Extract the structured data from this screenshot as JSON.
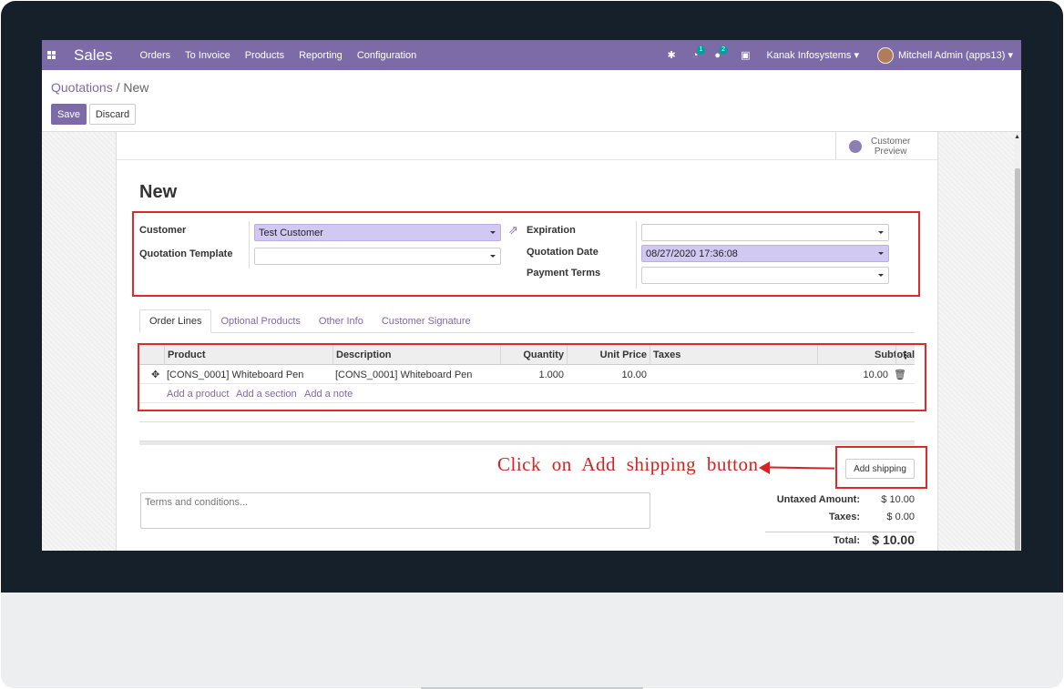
{
  "navbar": {
    "brand": "Sales",
    "menu": [
      "Orders",
      "To Invoice",
      "Products",
      "Reporting",
      "Configuration"
    ],
    "activities_badge": "1",
    "messages_badge": "2",
    "company": "Kanak Infosystems",
    "user": "Mitchell Admin (apps13)"
  },
  "control": {
    "breadcrumb_parent": "Quotations",
    "breadcrumb_separator": "/",
    "breadcrumb_current": "New",
    "save_label": "Save",
    "discard_label": "Discard"
  },
  "form": {
    "customer_preview_line1": "Customer",
    "customer_preview_line2": "Preview",
    "title": "New",
    "customer_label": "Customer",
    "customer_value": "Test Customer",
    "template_label": "Quotation Template",
    "template_value": "",
    "expiration_label": "Expiration",
    "expiration_value": "",
    "quotation_date_label": "Quotation Date",
    "quotation_date_value": "08/27/2020 17:36:08",
    "payment_terms_label": "Payment Terms",
    "payment_terms_value": ""
  },
  "tabs": [
    "Order Lines",
    "Optional Products",
    "Other Info",
    "Customer Signature"
  ],
  "table": {
    "headers": {
      "product": "Product",
      "description": "Description",
      "quantity": "Quantity",
      "unit_price": "Unit Price",
      "taxes": "Taxes",
      "subtotal": "Subtotal"
    },
    "rows": [
      {
        "product": "[CONS_0001] Whiteboard Pen",
        "description": "[CONS_0001] Whiteboard Pen",
        "quantity": "1.000",
        "unit_price": "10.00",
        "taxes": "",
        "subtotal": "10.00"
      }
    ],
    "add_product": "Add a product",
    "add_section": "Add a section",
    "add_note": "Add a note"
  },
  "shipping_button": "Add shipping",
  "annotation": "Click on Add shipping button",
  "terms_placeholder": "Terms and conditions...",
  "totals": {
    "untaxed_label": "Untaxed Amount:",
    "untaxed_value": "$ 10.00",
    "taxes_label": "Taxes:",
    "taxes_value": "$ 0.00",
    "total_label": "Total:",
    "total_value": "$ 10.00"
  },
  "colors": {
    "accent": "#7c6ba6",
    "required_field": "#d2c9f2",
    "annotation": "#d42323"
  }
}
